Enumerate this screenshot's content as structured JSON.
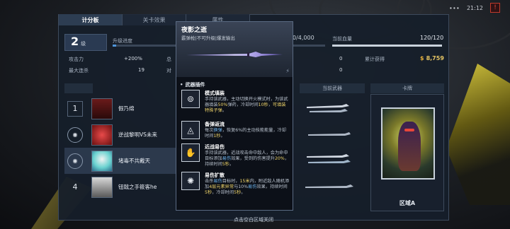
{
  "status": {
    "signal": "∙∙∙",
    "time": "21:12"
  },
  "tabs": [
    {
      "label": "计分板",
      "active": true
    },
    {
      "label": "关卡效果",
      "active": false
    },
    {
      "label": "属性",
      "active": false
    }
  ],
  "stats": {
    "level_num": "2",
    "level_unit": "级",
    "upgrade_label": "升级进度",
    "upgrade_progress": 0.05,
    "xp_text": "0/4,000",
    "hp_label": "当前血量",
    "hp_text": "120/120",
    "rows": [
      {
        "label": "攻击力",
        "value": "+200%"
      },
      {
        "label": "最大连杀",
        "value": "19"
      }
    ],
    "col2_labels": [
      "总",
      "对"
    ],
    "mid_values": [
      "0",
      "0"
    ],
    "earned_label": "累计获得",
    "gold": "8,759",
    "gold_symbol": "$"
  },
  "sub_headers": {
    "weapon": "当前武器",
    "card": "卡牌"
  },
  "players": [
    {
      "rank": "1",
      "name": "假乃绵",
      "medal": false,
      "highlight": false
    },
    {
      "rank": "",
      "name": "逆战黎明VS未来",
      "medal": true,
      "highlight": false
    },
    {
      "rank": "",
      "name": "堵毒不共戴天",
      "medal": true,
      "highlight": true
    },
    {
      "rank": "4",
      "name": "钮戟之手筱客he",
      "medal": false,
      "highlight": false
    }
  ],
  "card": {
    "zone": "区域A"
  },
  "footer": "点击空白区域关闭",
  "popup": {
    "title": "夜影之逝",
    "subtitle": "霰弹枪|不可升级|爆发输出",
    "section": "武器插件",
    "perks": [
      {
        "icon": "ring-icon",
        "title": "模式填装",
        "desc_parts": [
          "手持该武器，主动切换开火模式时，为该武器填装",
          "50%",
          "弹药，冷却时间",
          "10秒",
          "，",
          "可填装特殊子弹",
          "。"
        ]
      },
      {
        "icon": "triangle-icon",
        "title": "备弹返流",
        "desc_parts": [
          "每次",
          "换弹",
          "，恢复6%的主动技能能量，冷却时间",
          "1秒",
          "。"
        ]
      },
      {
        "icon": "hand-icon",
        "title": "近战易伤",
        "desc_parts": [
          "手持该武器，近战攻击命中敌人，会为命中目标添加",
          "易伤",
          "效果，受到的伤害提升",
          "20%",
          "，持续时间",
          "5秒",
          "。"
        ]
      },
      {
        "icon": "burst-icon",
        "title": "易伤扩散",
        "desc_parts": [
          "击杀",
          "易伤",
          "目标时，",
          "15米",
          "内，附近敌人随机添加",
          "4层元素异常",
          "与10%",
          "易伤",
          "效果，持续时间",
          "5秒",
          "，冷却时间",
          "5秒",
          "。"
        ]
      }
    ]
  },
  "colors": {
    "accent": "#4f95d9",
    "gold": "#e8c765",
    "highlight": "#f0d56a",
    "blue_hl": "#6fb6f0"
  }
}
